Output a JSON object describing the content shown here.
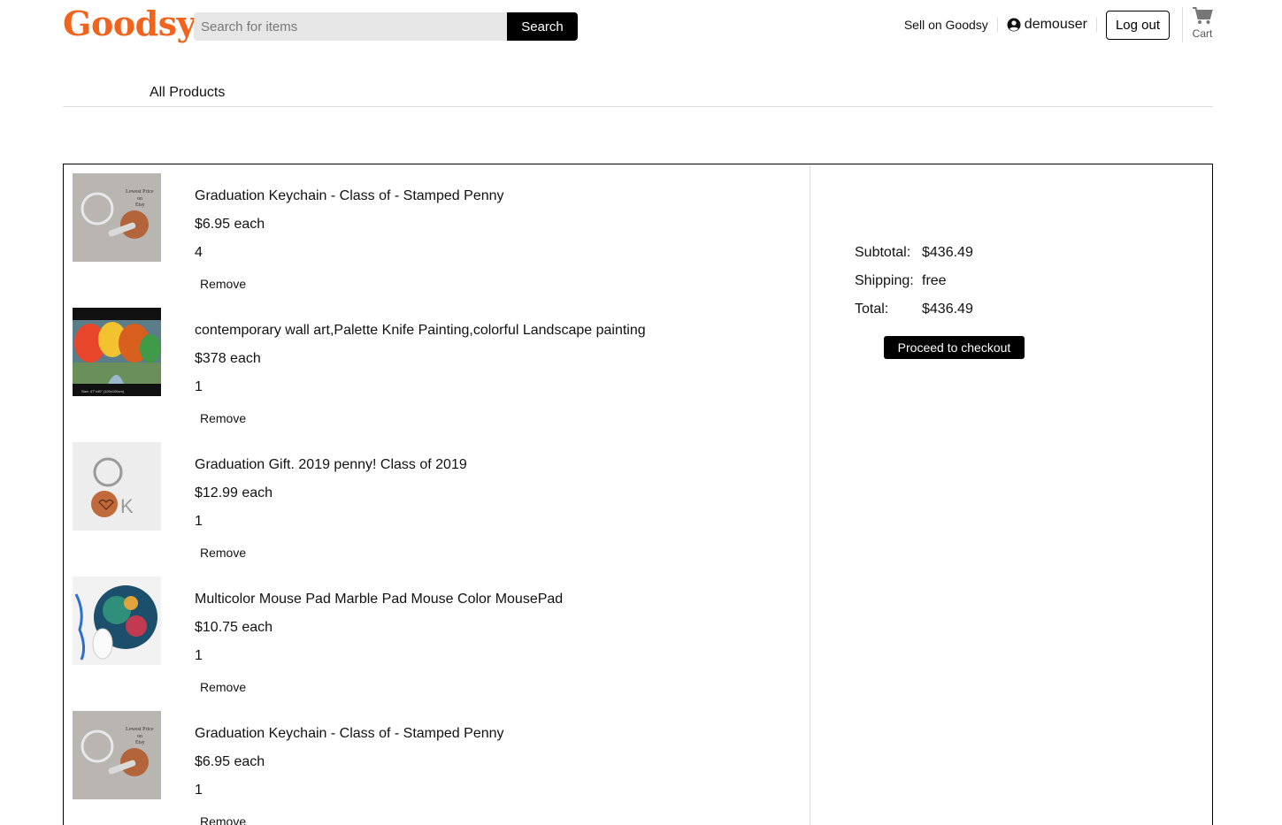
{
  "header": {
    "logo": "Goodsy",
    "search_placeholder": "Search for items",
    "search_button": "Search",
    "sell_link": "Sell on Goodsy",
    "username": "demouser",
    "logout": "Log out",
    "cart_label": "Cart",
    "brand_color": "#f1641e"
  },
  "nav": {
    "all_products": "All Products"
  },
  "cart_items": [
    {
      "title": "Graduation Keychain - Class of - Stamped Penny",
      "price": "$6.95 each",
      "quantity": "4",
      "remove": "Remove",
      "image": "keychain-penny"
    },
    {
      "title": "contemporary wall art,Palette Knife Painting,colorful Landscape painting",
      "price": "$378 each",
      "quantity": "1",
      "remove": "Remove",
      "image": "landscape-painting"
    },
    {
      "title": "Graduation Gift. 2019 penny! Class of 2019",
      "price": "$12.99 each",
      "quantity": "1",
      "remove": "Remove",
      "image": "penny-letter-keychain"
    },
    {
      "title": "Multicolor Mouse Pad Marble Pad Mouse Color MousePad",
      "price": "$10.75 each",
      "quantity": "1",
      "remove": "Remove",
      "image": "marble-mousepad"
    },
    {
      "title": "Graduation Keychain - Class of - Stamped Penny",
      "price": "$6.95 each",
      "quantity": "1",
      "remove": "Remove",
      "image": "keychain-penny"
    }
  ],
  "summary": {
    "subtotal_label": "Subtotal:",
    "subtotal_value": "$436.49",
    "shipping_label": "Shipping:",
    "shipping_value": "free",
    "total_label": "Total:",
    "total_value": "$436.49",
    "checkout_button": "Proceed to checkout"
  }
}
